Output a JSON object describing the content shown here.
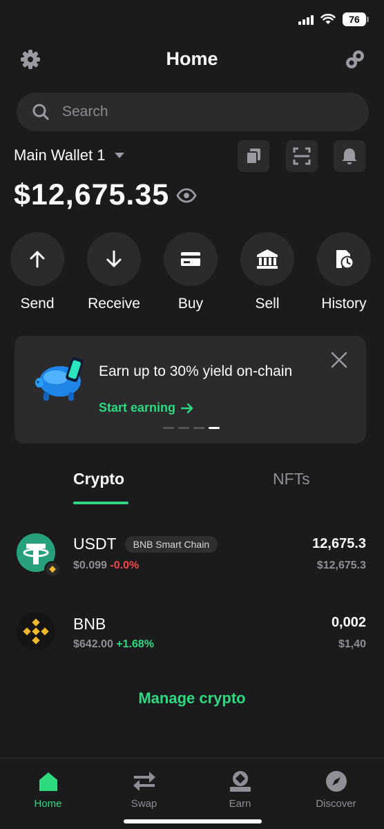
{
  "status_bar": {
    "battery": "76"
  },
  "header": {
    "title": "Home"
  },
  "search": {
    "placeholder": "Search"
  },
  "wallet": {
    "name": "Main Wallet 1",
    "balance": "$12,675.35"
  },
  "actions": [
    {
      "label": "Send",
      "icon": "arrow-up-icon"
    },
    {
      "label": "Receive",
      "icon": "arrow-down-icon"
    },
    {
      "label": "Buy",
      "icon": "card-icon"
    },
    {
      "label": "Sell",
      "icon": "bank-icon"
    },
    {
      "label": "History",
      "icon": "history-icon"
    }
  ],
  "promo": {
    "title": "Earn up to 30% yield on-chain",
    "cta": "Start earning",
    "active_slide": 4,
    "slide_count": 4
  },
  "tabs": {
    "crypto": "Crypto",
    "nfts": "NFTs",
    "active": "Crypto"
  },
  "assets": [
    {
      "symbol": "USDT",
      "chain": "BNB Smart Chain",
      "price": "$0.099",
      "change": "-0.0%",
      "amount": "12,675.3",
      "fiat": "$12,675.3"
    },
    {
      "symbol": "BNB",
      "chain": "",
      "price": "$642.00",
      "change": "+1.68%",
      "amount": "0,002",
      "fiat": "$1,40"
    }
  ],
  "manage_label": "Manage crypto",
  "nav": [
    {
      "label": "Home",
      "icon": "home-icon",
      "active": true
    },
    {
      "label": "Swap",
      "icon": "swap-icon",
      "active": false
    },
    {
      "label": "Earn",
      "icon": "earn-icon",
      "active": false
    },
    {
      "label": "Discover",
      "icon": "compass-icon",
      "active": false
    }
  ],
  "colors": {
    "background": "#1b1b1d",
    "surface": "#2b2b2e",
    "accent": "#2fd980",
    "negative": "#f04848",
    "tether": "#26a17b",
    "bnb": "#f3ba2f"
  }
}
